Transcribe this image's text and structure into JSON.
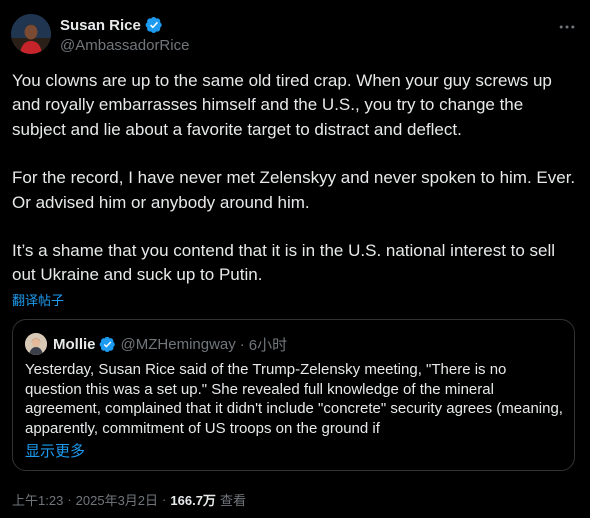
{
  "colors": {
    "background": "#000000",
    "text": "#e7e9ea",
    "muted": "#71767b",
    "link": "#1d9bf0",
    "verified_badge": "#1d9bf0",
    "border": "#2f3336"
  },
  "author": {
    "name": "Susan Rice",
    "handle": "@AmbassadorRice",
    "verified_icon": "verified-badge-icon",
    "avatar_icon": "avatar"
  },
  "menu_icon": "more-horizontal-icon",
  "tweet": {
    "paragraphs": [
      "You clowns are up to the same old tired crap. When your guy screws up and royally embarrasses himself and the U.S., you try to change the subject and lie about a favorite target to distract and deflect.",
      "For the record, I have never met Zelenskyy and never spoken to him. Ever.  Or advised him or anybody around him.",
      "It’s a shame that you contend that it is in the U.S. national interest to sell out Ukraine and suck up to Putin."
    ],
    "translate_label": "翻译帖子"
  },
  "quote": {
    "name": "Mollie",
    "handle": "@MZHemingway",
    "dot": "·",
    "time": "6小时",
    "text": "Yesterday, Susan Rice said of the Trump-Zelensky meeting, \"There is no question this was a set up.\" She revealed full knowledge of the mineral agreement, complained that it didn't include \"concrete\" security agrees (meaning, apparently, commitment of US troops on the ground if",
    "show_more": "显示更多"
  },
  "meta": {
    "time": "上午1:23",
    "sep1": "·",
    "date": "2025年3月2日",
    "sep2": "·",
    "views": "166.7万",
    "views_label": "查看"
  }
}
